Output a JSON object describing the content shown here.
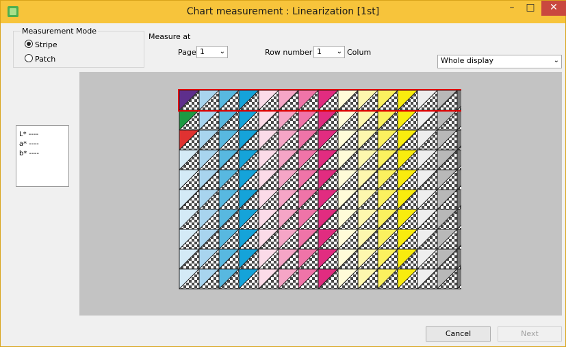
{
  "window": {
    "title": "Chart measurement : Linearization [1st]",
    "min_glyph": "–",
    "max_glyph": "□",
    "close_glyph": "✕"
  },
  "mode": {
    "group_title": "Measurement Mode",
    "stripe": "Stripe",
    "patch": "Patch",
    "selected": "Stripe"
  },
  "measure": {
    "heading": "Measure at",
    "page_label": "Page",
    "page_value": "1",
    "row_label": "Row number",
    "row_value": "1",
    "column_label": "Colum",
    "display_value": "Whole display"
  },
  "lab": {
    "l": "L* ----",
    "a": "a* ----",
    "b": "b* ----"
  },
  "chart": {
    "columns": [
      "#d4eaf6",
      "#a8d4ee",
      "#58b8e0",
      "#15a3d9",
      "#fbdbe8",
      "#f5a5c6",
      "#ef74a8",
      "#e12c80",
      "#fffbd8",
      "#fdf7ae",
      "#fbf15f",
      "#f9ec0e",
      "#eeeeee",
      "#b8b8b8",
      "#767676",
      "#3c3c3c"
    ],
    "first_column_overrides": [
      "#5e2f8c",
      "#1c9a43",
      "#e03231"
    ],
    "selected_row": 0
  },
  "buttons": {
    "cancel": "Cancel",
    "next": "Next"
  }
}
